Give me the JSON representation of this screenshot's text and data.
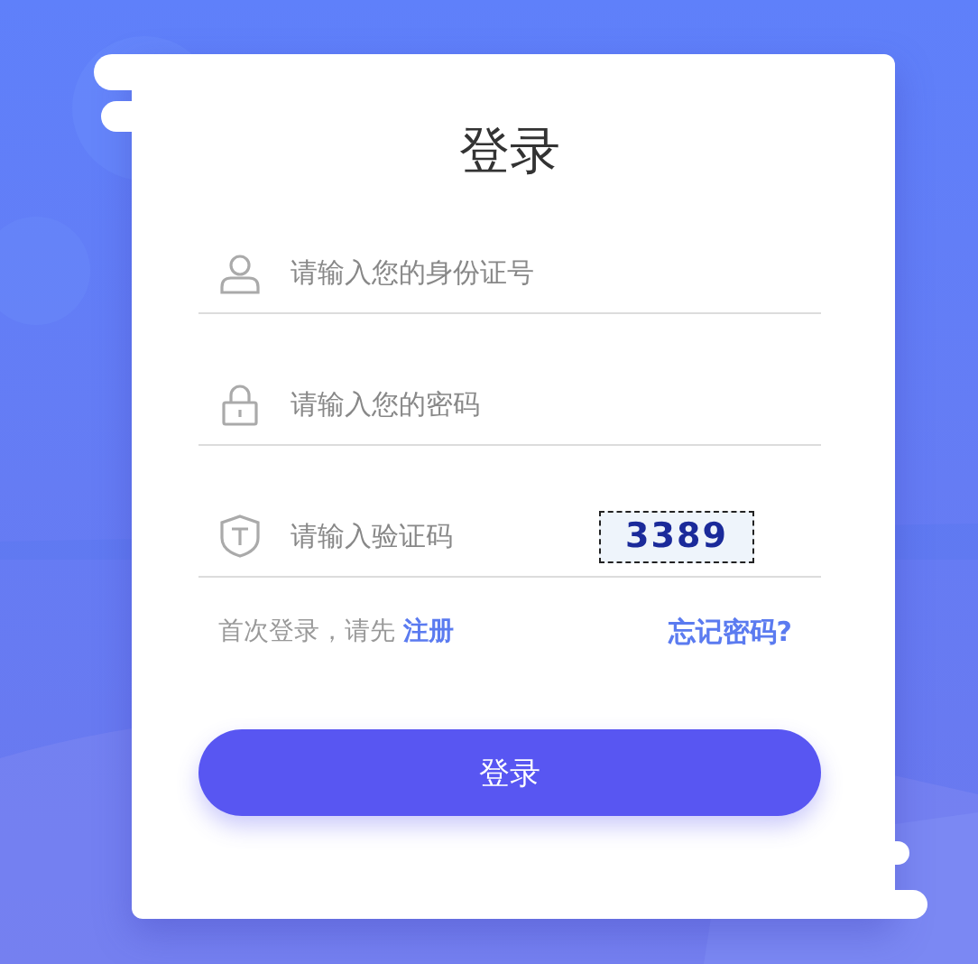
{
  "title": "登录",
  "fields": [
    {
      "kind": "user",
      "placeholder": "请输入您的身份证号"
    },
    {
      "kind": "lock",
      "placeholder": "请输入您的密码"
    },
    {
      "kind": "shield",
      "placeholder": "请输入验证码",
      "captcha": "3389"
    }
  ],
  "register": {
    "text": "首次登录，请先",
    "link": "注册"
  },
  "forgot": "忘记密码?",
  "button": "登录"
}
